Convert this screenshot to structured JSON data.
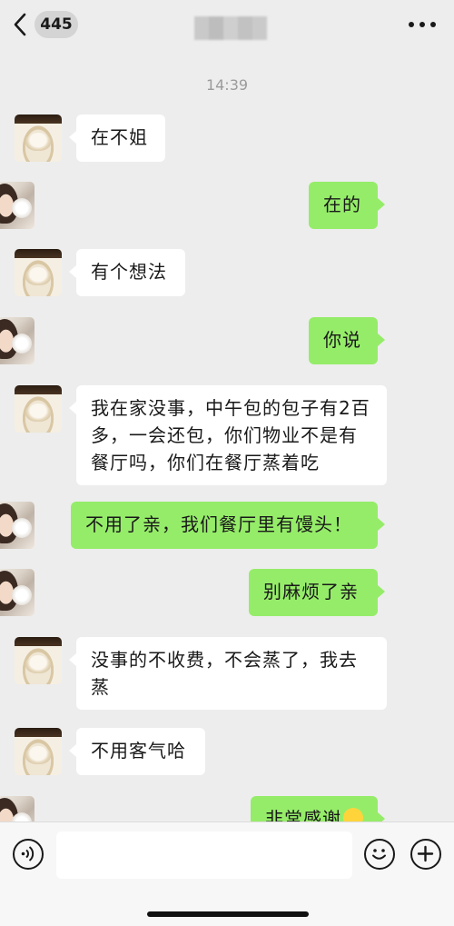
{
  "header": {
    "back_icon": "chevron-left-icon",
    "unread_count": "445",
    "title": "",
    "more_icon": "more-dots-icon"
  },
  "chat": {
    "timestamp": "14:39",
    "messages": [
      {
        "side": "left",
        "text": "在不姐"
      },
      {
        "side": "right",
        "text": "在的"
      },
      {
        "side": "left",
        "text": "有个想法"
      },
      {
        "side": "right",
        "text": "你说"
      },
      {
        "side": "left",
        "text": "我在家没事，中午包的包子有2百多，一会还包，你们物业不是有餐厅吗，你们在餐厅蒸着吃"
      },
      {
        "side": "right",
        "text": "不用了亲，我们餐厅里有馒头！"
      },
      {
        "side": "right",
        "text": "别麻烦了亲"
      },
      {
        "side": "left",
        "text": "没事的不收费，不会蒸了，我去蒸"
      },
      {
        "side": "left",
        "text": "不用客气哈"
      },
      {
        "side": "right",
        "text": "非常感谢"
      }
    ]
  },
  "input_bar": {
    "voice_icon": "voice-icon",
    "placeholder": "",
    "emoji_icon": "smile-icon",
    "plus_icon": "plus-icon"
  },
  "colors": {
    "background": "#ededed",
    "sent_bubble": "#95ec69",
    "received_bubble": "#ffffff"
  }
}
